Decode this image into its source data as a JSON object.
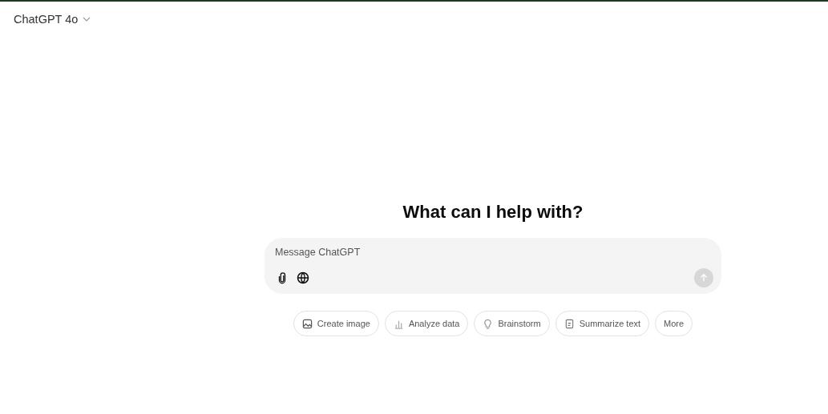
{
  "header": {
    "model": "ChatGPT 4o"
  },
  "heading": "What can I help with?",
  "composer": {
    "placeholder": "Message ChatGPT",
    "send_disabled": true
  },
  "suggestions": [
    {
      "kind": "image",
      "label": "Create image"
    },
    {
      "kind": "data",
      "label": "Analyze data"
    },
    {
      "kind": "idea",
      "label": "Brainstorm"
    },
    {
      "kind": "summary",
      "label": "Summarize text"
    },
    {
      "kind": "more",
      "label": "More"
    }
  ]
}
